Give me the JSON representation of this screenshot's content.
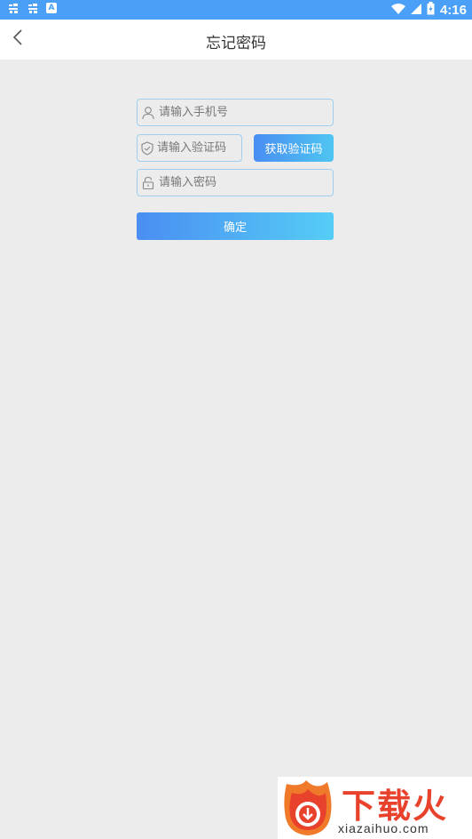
{
  "status_bar": {
    "time": "4:16",
    "left_icons": [
      "notification-icon",
      "notification-icon",
      "a-icon"
    ],
    "a_icon_letter": "A",
    "right_icons": [
      "wifi-icon",
      "signal-icon",
      "battery-icon"
    ]
  },
  "header": {
    "title": "忘记密码",
    "back_icon": "chevron-left-icon"
  },
  "form": {
    "phone_placeholder": "请输入手机号",
    "code_placeholder": "请输入验证码",
    "password_placeholder": "请输入密码",
    "get_code_label": "获取验证码",
    "confirm_label": "确定"
  },
  "watermark": {
    "brand": "下载火",
    "url": "xiazaihuo.com"
  },
  "colors": {
    "status_bar": "#4a9ff6",
    "accent_start": "#4a8ef2",
    "accent_end": "#4ec6f2",
    "background": "#ececec",
    "field_border": "#9fcff0",
    "brand_red": "#e8412c"
  }
}
